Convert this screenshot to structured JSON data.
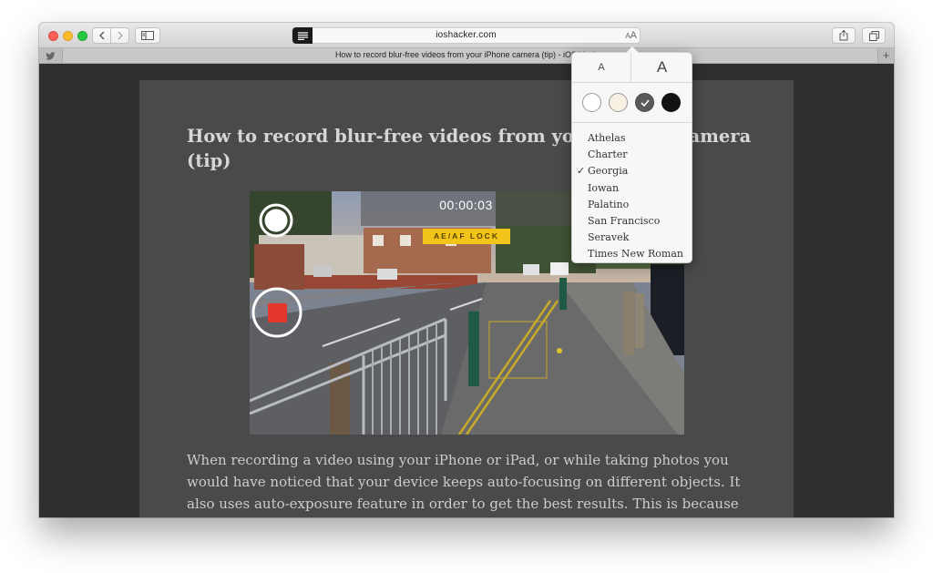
{
  "browser": {
    "url": "ioshacker.com",
    "tab_title": "How to record blur-free videos from your iPhone camera (tip) - iOS Hacker",
    "aa_small": "A",
    "aa_large": "A",
    "new_tab_label": "+"
  },
  "article": {
    "title": "How to record blur-free videos from your iPhone camera (tip)",
    "body": "When recording a video using your iPhone or iPad, or while taking photos you would have noticed that your device keeps auto-focusing on different objects. It also uses auto-exposure feature in order to get the best results. This is because the Camera app is",
    "image": {
      "timer": "00:00:03",
      "badge": "AE/AF LOCK"
    }
  },
  "reader_popover": {
    "size_small": "A",
    "size_large": "A",
    "themes": [
      {
        "name": "white",
        "color": "#ffffff"
      },
      {
        "name": "sepia",
        "color": "#f8f1e3"
      },
      {
        "name": "gray",
        "color": "#5a5a5c",
        "selected": true
      },
      {
        "name": "night",
        "color": "#121212"
      }
    ],
    "fonts": [
      "Athelas",
      "Charter",
      "Georgia",
      "Iowan",
      "Palatino",
      "San Francisco",
      "Seravek",
      "Times New Roman"
    ],
    "selected_font": "Georgia",
    "check_mark": "✓"
  }
}
